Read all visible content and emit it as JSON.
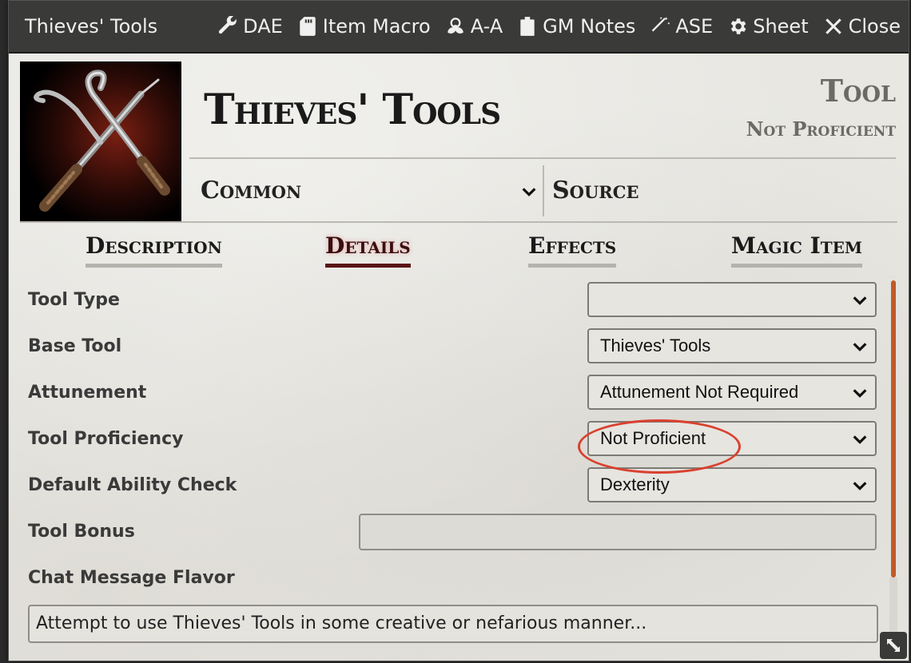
{
  "window": {
    "title": "Thieves' Tools",
    "buttons": [
      {
        "icon": "wrench-icon",
        "label": "DAE"
      },
      {
        "icon": "sd-card-icon",
        "label": "Item Macro"
      },
      {
        "icon": "biohazard-icon",
        "label": "A-A"
      },
      {
        "icon": "clipboard-icon",
        "label": "GM Notes"
      },
      {
        "icon": "magic-wand-icon",
        "label": "ASE"
      },
      {
        "icon": "gear-icon",
        "label": "Sheet"
      },
      {
        "icon": "close-icon",
        "label": "Close"
      }
    ]
  },
  "header": {
    "name": "Thieves' Tools",
    "type": "Tool",
    "proficiency": "Not Proficient",
    "rarity": "Common",
    "source_placeholder": "Source"
  },
  "tabs": [
    {
      "label": "Description",
      "active": false
    },
    {
      "label": "Details",
      "active": true
    },
    {
      "label": "Effects",
      "active": false
    },
    {
      "label": "Magic Item",
      "active": false
    }
  ],
  "details": {
    "tool_type": {
      "label": "Tool Type",
      "value": ""
    },
    "base_tool": {
      "label": "Base Tool",
      "value": "Thieves' Tools"
    },
    "attunement": {
      "label": "Attunement",
      "value": "Attunement Not Required"
    },
    "tool_proficiency": {
      "label": "Tool Proficiency",
      "value": "Not Proficient"
    },
    "default_ability": {
      "label": "Default Ability Check",
      "value": "Dexterity"
    },
    "tool_bonus": {
      "label": "Tool Bonus",
      "value": ""
    },
    "chat_flavor": {
      "label": "Chat Message Flavor",
      "value": "Attempt to use Thieves' Tools in some creative or nefarious manner..."
    }
  },
  "colors": {
    "titlebar": "#3a3a38",
    "active_tab": "#5a1616",
    "scrollbar": "#c15a2a",
    "annotation": "#d9412f"
  }
}
